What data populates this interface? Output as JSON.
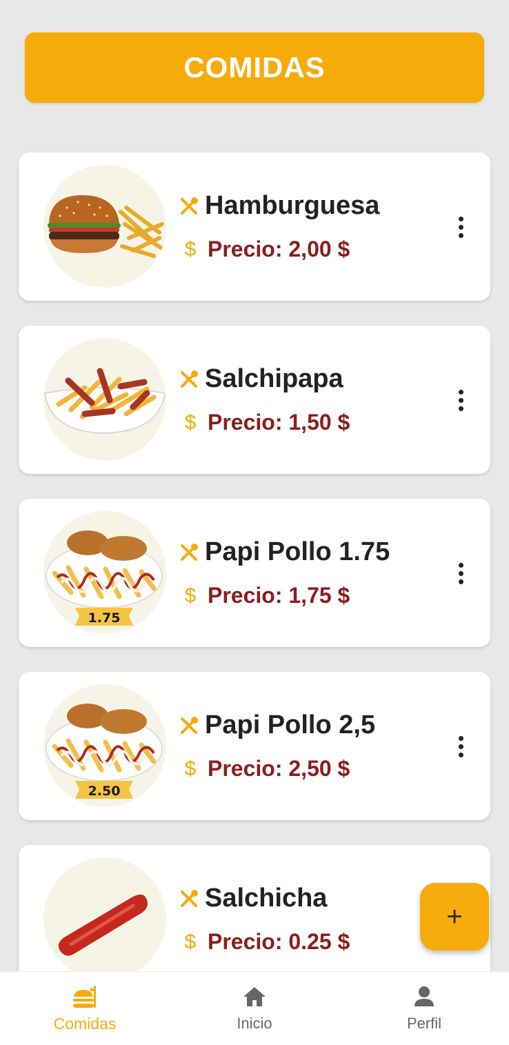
{
  "header": {
    "title": "COMIDAS"
  },
  "items": [
    {
      "name": "Hamburguesa",
      "price": "Precio: 2,00 $",
      "image": "burger-with-fries-image"
    },
    {
      "name": "Salchipapa",
      "price": "Precio: 1,50 $",
      "image": "salchipapa-image"
    },
    {
      "name": "Papi Pollo 1.75",
      "price": "Precio: 1,75 $",
      "image": "chicken-fries-image",
      "badge": "1.75"
    },
    {
      "name": "Papi Pollo 2,5",
      "price": "Precio: 2,50 $",
      "image": "chicken-fries-image",
      "badge": "2.50"
    },
    {
      "name": "Salchicha",
      "price": "Precio: 0.25 $",
      "image": "sausage-image"
    }
  ],
  "fab": {
    "icon": "plus-icon",
    "symbol": "+"
  },
  "nav": {
    "items": [
      {
        "label": "Comidas",
        "icon": "burger-utensil-icon",
        "active": true
      },
      {
        "label": "Inicio",
        "icon": "home-icon",
        "active": false
      },
      {
        "label": "Perfil",
        "icon": "person-icon",
        "active": false
      }
    ]
  },
  "colors": {
    "accent": "#f6ab0a",
    "price": "#8c1d1d",
    "background": "#e8e8e8"
  },
  "icons": {
    "dollar": "$"
  }
}
